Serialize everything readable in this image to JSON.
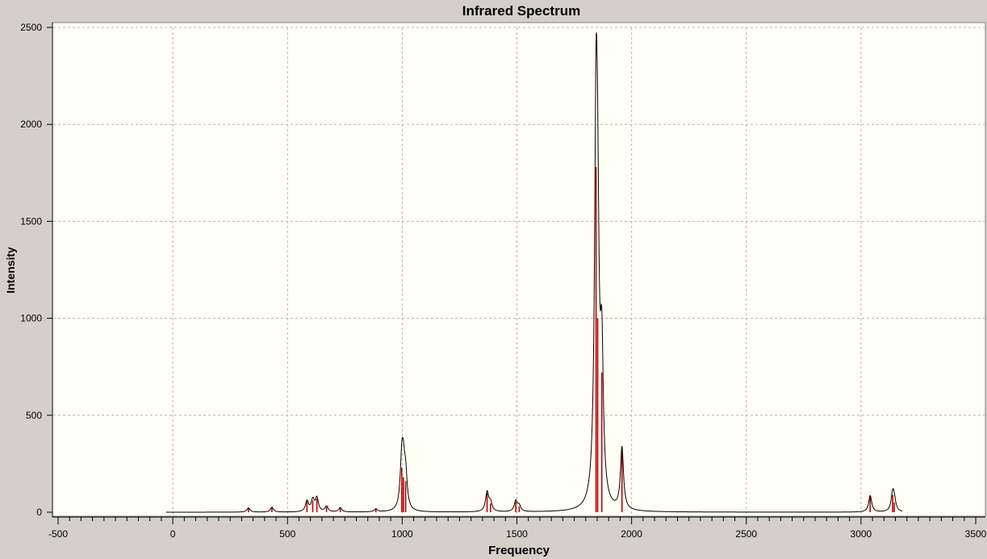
{
  "window": {
    "title": "Infrared Spectrum"
  },
  "chart_data": {
    "type": "line",
    "title": "Infrared Spectrum",
    "xlabel": "Frequency",
    "ylabel": "Intensity",
    "xlim": [
      -500,
      3500
    ],
    "ylim": [
      0,
      2500
    ],
    "x_ticks": [
      "-500",
      "0",
      "500",
      "1000",
      "1500",
      "2000",
      "2500",
      "3000",
      "3500"
    ],
    "y_ticks": [
      "0",
      "500",
      "1000",
      "1500",
      "2000",
      "2500"
    ],
    "grid": true,
    "legend": "none",
    "colors": {
      "plot_bg": "#fffff5",
      "spectrum": "#000000",
      "sticks": "#c00000",
      "grid": "#b4b4b4"
    },
    "series": [
      {
        "role": "spectrum-curve",
        "x_range": [
          -30,
          3180
        ],
        "linewidth_hwhm": 8
      },
      {
        "role": "stick-lines",
        "peaks": [
          {
            "x": 330,
            "y": 22
          },
          {
            "x": 432,
            "y": 25
          },
          {
            "x": 585,
            "y": 55
          },
          {
            "x": 610,
            "y": 60
          },
          {
            "x": 628,
            "y": 70
          },
          {
            "x": 670,
            "y": 28
          },
          {
            "x": 730,
            "y": 22
          },
          {
            "x": 885,
            "y": 15
          },
          {
            "x": 998,
            "y": 230
          },
          {
            "x": 1005,
            "y": 180
          },
          {
            "x": 1015,
            "y": 160
          },
          {
            "x": 1370,
            "y": 100
          },
          {
            "x": 1385,
            "y": 45
          },
          {
            "x": 1495,
            "y": 55
          },
          {
            "x": 1510,
            "y": 30
          },
          {
            "x": 1845,
            "y": 1780
          },
          {
            "x": 1852,
            "y": 1000
          },
          {
            "x": 1870,
            "y": 720
          },
          {
            "x": 1958,
            "y": 320
          },
          {
            "x": 3040,
            "y": 85
          },
          {
            "x": 3138,
            "y": 90
          },
          {
            "x": 3145,
            "y": 50
          }
        ]
      }
    ]
  }
}
